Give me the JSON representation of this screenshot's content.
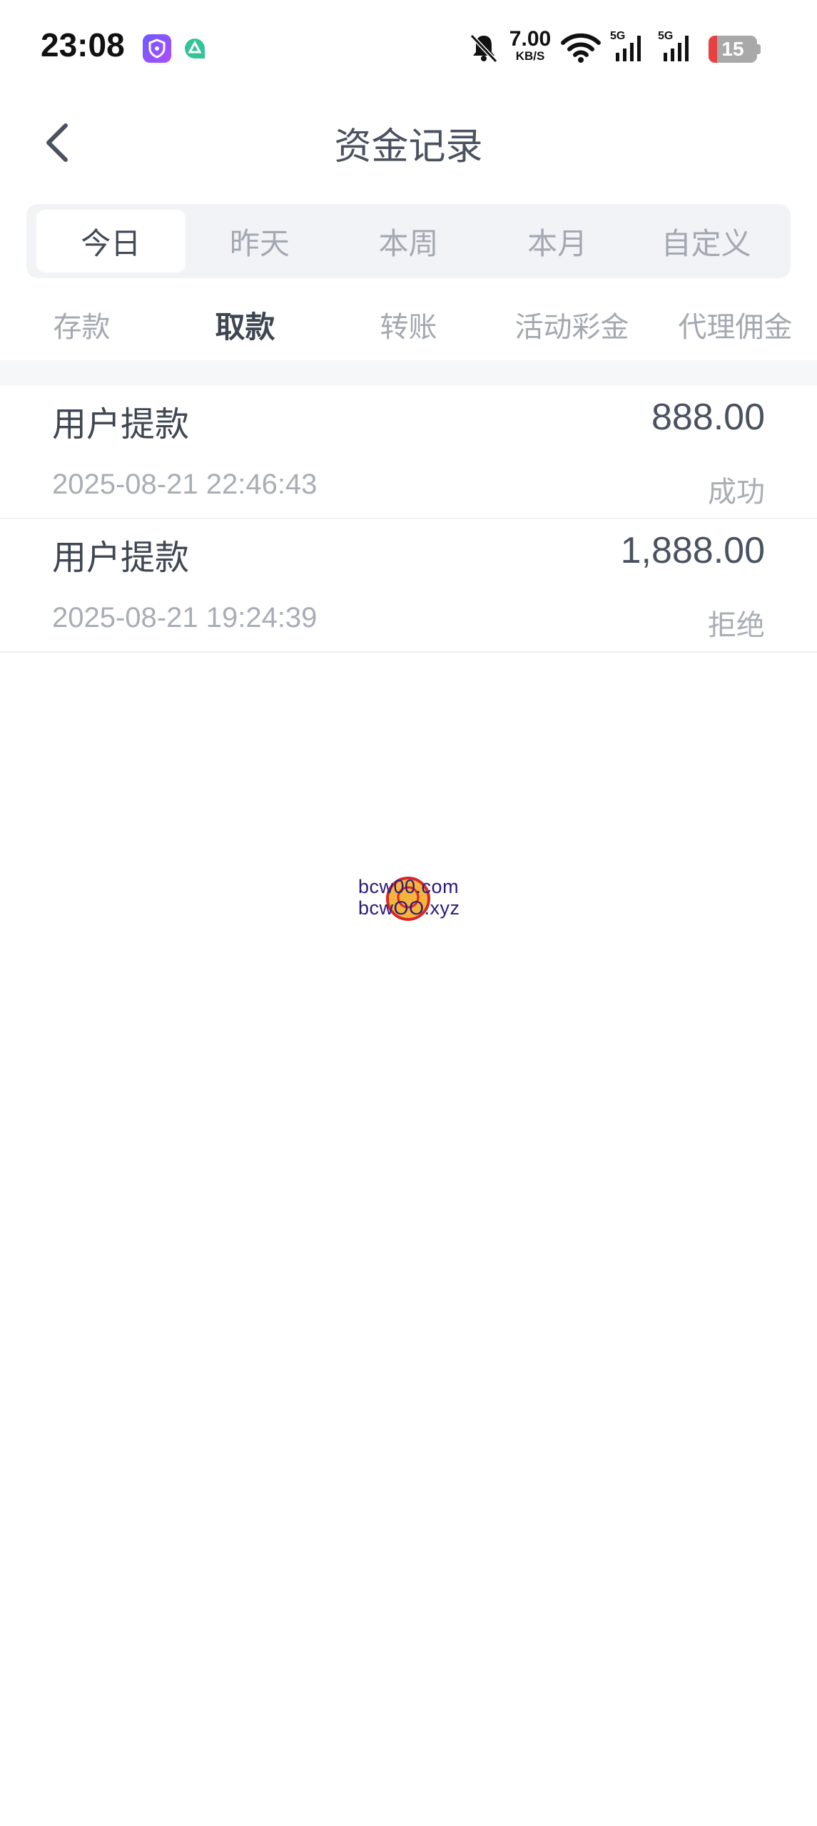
{
  "status_bar": {
    "time": "23:08",
    "net_speed_value": "7.00",
    "net_speed_unit": "KB/S",
    "signal_label_1": "5G",
    "signal_label_2": "5G",
    "battery_level": "15",
    "icons": [
      "shield-app-icon",
      "chat-app-icon",
      "bell-muted-icon",
      "wifi-icon",
      "signal-icon",
      "signal-icon",
      "battery-icon"
    ]
  },
  "header": {
    "title": "资金记录"
  },
  "period_tabs": [
    "今日",
    "昨天",
    "本周",
    "本月",
    "自定义"
  ],
  "period_selected": "今日",
  "category_tabs": [
    "存款",
    "取款",
    "转账",
    "活动彩金",
    "代理佣金"
  ],
  "category_selected": "取款",
  "records": [
    {
      "title": "用户提款",
      "amount": "888.00",
      "time": "2025-08-21 22:46:43",
      "status": "成功"
    },
    {
      "title": "用户提款",
      "amount": "1,888.00",
      "time": "2025-08-21 19:24:39",
      "status": "拒绝"
    }
  ],
  "watermark": {
    "line1": "bcw00.com",
    "line2": "bcwOO.xyz"
  },
  "colors": {
    "battery_low": "#e84141",
    "title_text": "#4a5260",
    "muted_text": "#a3a8b1"
  }
}
